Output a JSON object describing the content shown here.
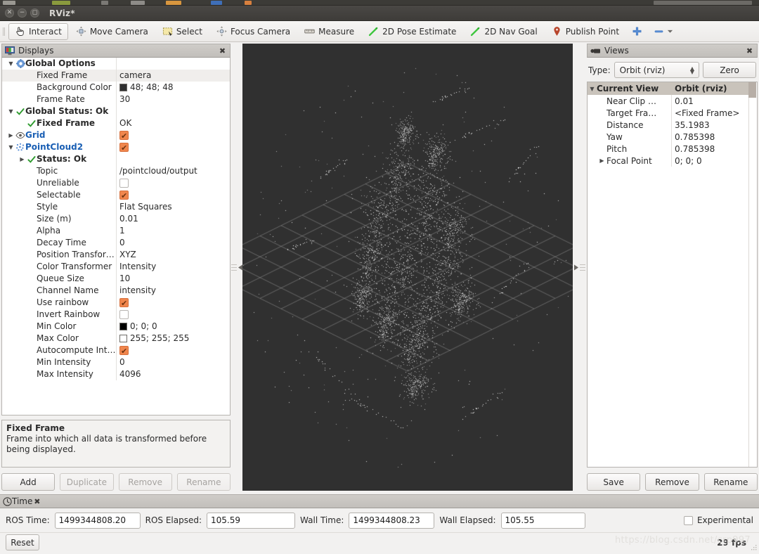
{
  "window": {
    "title": "RViz*",
    "buttons": {
      "close": "close-icon",
      "minimize": "minimize-icon",
      "maximize": "maximize-icon"
    }
  },
  "toolbar": {
    "items": [
      {
        "label": "Interact",
        "icon": "hand-cursor-icon",
        "checked": true
      },
      {
        "label": "Move Camera",
        "icon": "move-camera-icon",
        "checked": false
      },
      {
        "label": "Select",
        "icon": "selection-rect-icon",
        "checked": false
      },
      {
        "label": "Focus Camera",
        "icon": "focus-camera-icon",
        "checked": false
      },
      {
        "label": "Measure",
        "icon": "ruler-icon",
        "checked": false
      },
      {
        "label": "2D Pose Estimate",
        "icon": "green-arrow-icon",
        "checked": false
      },
      {
        "label": "2D Nav Goal",
        "icon": "green-arrow-icon",
        "checked": false
      },
      {
        "label": "Publish Point",
        "icon": "map-pin-icon",
        "checked": false
      }
    ],
    "add_tool_label": "+",
    "overflow_label": "—"
  },
  "displays": {
    "title": "Displays",
    "title_icon": "displays-monitor-icon",
    "close_icon": "close-icon",
    "rows": [
      {
        "indent": 0,
        "arrow": "down",
        "icon": "gear-icon",
        "name": "Global Options",
        "value": "",
        "vtype": "text",
        "style": "plain-bold",
        "alt": false
      },
      {
        "indent": 1,
        "arrow": "none",
        "icon": "none",
        "name": "Fixed Frame",
        "value": "camera",
        "vtype": "text",
        "style": "plain",
        "alt": true
      },
      {
        "indent": 1,
        "arrow": "none",
        "icon": "none",
        "name": "Background Color",
        "value": "48; 48; 48",
        "vtype": "color",
        "swatch": "#303030",
        "style": "plain",
        "alt": false
      },
      {
        "indent": 1,
        "arrow": "none",
        "icon": "none",
        "name": "Frame Rate",
        "value": "30",
        "vtype": "text",
        "style": "plain",
        "alt": false
      },
      {
        "indent": 0,
        "arrow": "down",
        "icon": "check-icon",
        "name": "Global Status: Ok",
        "value": "",
        "vtype": "text",
        "style": "plain-bold",
        "alt": false
      },
      {
        "indent": 1,
        "arrow": "none",
        "icon": "check-icon",
        "name": "Fixed Frame",
        "value": "OK",
        "vtype": "text",
        "style": "plain-bold",
        "alt": false
      },
      {
        "indent": 0,
        "arrow": "right",
        "icon": "eye-icon",
        "name": "Grid",
        "value": "",
        "vtype": "checkbox",
        "checked": true,
        "style": "blue-bold",
        "alt": false
      },
      {
        "indent": 0,
        "arrow": "down",
        "icon": "pointcloud-icon",
        "name": "PointCloud2",
        "value": "",
        "vtype": "checkbox",
        "checked": true,
        "style": "blue-bold",
        "alt": false
      },
      {
        "indent": 1,
        "arrow": "right",
        "icon": "check-icon",
        "name": "Status: Ok",
        "value": "",
        "vtype": "text",
        "style": "plain-bold",
        "alt": false
      },
      {
        "indent": 1,
        "arrow": "none",
        "icon": "none",
        "name": "Topic",
        "value": "/pointcloud/output",
        "vtype": "text",
        "style": "plain",
        "alt": false
      },
      {
        "indent": 1,
        "arrow": "none",
        "icon": "none",
        "name": "Unreliable",
        "value": "",
        "vtype": "checkbox",
        "checked": false,
        "style": "plain",
        "alt": false
      },
      {
        "indent": 1,
        "arrow": "none",
        "icon": "none",
        "name": "Selectable",
        "value": "",
        "vtype": "checkbox",
        "checked": true,
        "style": "plain",
        "alt": false
      },
      {
        "indent": 1,
        "arrow": "none",
        "icon": "none",
        "name": "Style",
        "value": "Flat Squares",
        "vtype": "text",
        "style": "plain",
        "alt": false
      },
      {
        "indent": 1,
        "arrow": "none",
        "icon": "none",
        "name": "Size (m)",
        "value": "0.01",
        "vtype": "text",
        "style": "plain",
        "alt": false
      },
      {
        "indent": 1,
        "arrow": "none",
        "icon": "none",
        "name": "Alpha",
        "value": "1",
        "vtype": "text",
        "style": "plain",
        "alt": false
      },
      {
        "indent": 1,
        "arrow": "none",
        "icon": "none",
        "name": "Decay Time",
        "value": "0",
        "vtype": "text",
        "style": "plain",
        "alt": false
      },
      {
        "indent": 1,
        "arrow": "none",
        "icon": "none",
        "name": "Position Transfor…",
        "value": "XYZ",
        "vtype": "text",
        "style": "plain",
        "alt": false
      },
      {
        "indent": 1,
        "arrow": "none",
        "icon": "none",
        "name": "Color Transformer",
        "value": "Intensity",
        "vtype": "text",
        "style": "plain",
        "alt": false
      },
      {
        "indent": 1,
        "arrow": "none",
        "icon": "none",
        "name": "Queue Size",
        "value": "10",
        "vtype": "text",
        "style": "plain",
        "alt": false
      },
      {
        "indent": 1,
        "arrow": "none",
        "icon": "none",
        "name": "Channel Name",
        "value": "intensity",
        "vtype": "text",
        "style": "plain",
        "alt": false
      },
      {
        "indent": 1,
        "arrow": "none",
        "icon": "none",
        "name": "Use rainbow",
        "value": "",
        "vtype": "checkbox",
        "checked": true,
        "style": "plain",
        "alt": false
      },
      {
        "indent": 1,
        "arrow": "none",
        "icon": "none",
        "name": "Invert Rainbow",
        "value": "",
        "vtype": "checkbox",
        "checked": false,
        "style": "plain",
        "alt": false
      },
      {
        "indent": 1,
        "arrow": "none",
        "icon": "none",
        "name": "Min Color",
        "value": "0; 0; 0",
        "vtype": "color",
        "swatch": "#000000",
        "style": "plain",
        "alt": false
      },
      {
        "indent": 1,
        "arrow": "none",
        "icon": "none",
        "name": "Max Color",
        "value": "255; 255; 255",
        "vtype": "color",
        "swatch": "#ffffff",
        "style": "plain",
        "alt": false
      },
      {
        "indent": 1,
        "arrow": "none",
        "icon": "none",
        "name": "Autocompute Int…",
        "value": "",
        "vtype": "checkbox",
        "checked": true,
        "style": "plain",
        "alt": false
      },
      {
        "indent": 1,
        "arrow": "none",
        "icon": "none",
        "name": "Min Intensity",
        "value": "0",
        "vtype": "text",
        "style": "plain",
        "alt": false
      },
      {
        "indent": 1,
        "arrow": "none",
        "icon": "none",
        "name": "Max Intensity",
        "value": "4096",
        "vtype": "text",
        "style": "plain",
        "alt": false
      }
    ],
    "help": {
      "title": "Fixed Frame",
      "text": "Frame into which all data is transformed before being displayed."
    },
    "buttons": [
      {
        "label": "Add",
        "disabled": false
      },
      {
        "label": "Duplicate",
        "disabled": true
      },
      {
        "label": "Remove",
        "disabled": true
      },
      {
        "label": "Rename",
        "disabled": true
      }
    ]
  },
  "views": {
    "title": "Views",
    "title_icon": "views-camera-icon",
    "close_icon": "close-icon",
    "type_label": "Type:",
    "type_value": "Orbit (rviz)",
    "zero_label": "Zero",
    "header": {
      "name": "Current View",
      "value": "Orbit (rviz)"
    },
    "rows": [
      {
        "name": "Near Clip …",
        "value": "0.01",
        "arrow": "none"
      },
      {
        "name": "Target Fra…",
        "value": "<Fixed Frame>",
        "arrow": "none"
      },
      {
        "name": "Distance",
        "value": "35.1983",
        "arrow": "none"
      },
      {
        "name": "Yaw",
        "value": "0.785398",
        "arrow": "none"
      },
      {
        "name": "Pitch",
        "value": "0.785398",
        "arrow": "none"
      },
      {
        "name": "Focal Point",
        "value": "0; 0; 0",
        "arrow": "right"
      }
    ],
    "buttons": [
      {
        "label": "Save",
        "disabled": false
      },
      {
        "label": "Remove",
        "disabled": false
      },
      {
        "label": "Rename",
        "disabled": false
      }
    ]
  },
  "time": {
    "title": "Time",
    "title_icon": "clock-icon",
    "close_icon": "close-icon",
    "fields": [
      {
        "label": "ROS Time:",
        "value": "1499344808.20",
        "width": "w-ros"
      },
      {
        "label": "ROS Elapsed:",
        "value": "105.59",
        "width": "w-ela"
      },
      {
        "label": "Wall Time:",
        "value": "1499344808.23",
        "width": "w-wall"
      },
      {
        "label": "Wall Elapsed:",
        "value": "105.55",
        "width": "w-wela"
      }
    ],
    "experimental_label": "Experimental",
    "experimental_checked": false,
    "reset_label": "Reset",
    "fps": "29 fps"
  },
  "watermark": "https://blog.csdn.net/crp997",
  "render": {
    "background_color": "#303030",
    "grid_color": "#8c8c8c",
    "point_color": "#ffffff"
  },
  "colors": {
    "accent_orange": "#f0864d",
    "link_blue": "#1a5fb4",
    "status_green": "#2e9b2e",
    "panel_bg": "#f2f1f0",
    "titlebar": "#3e3c39"
  }
}
